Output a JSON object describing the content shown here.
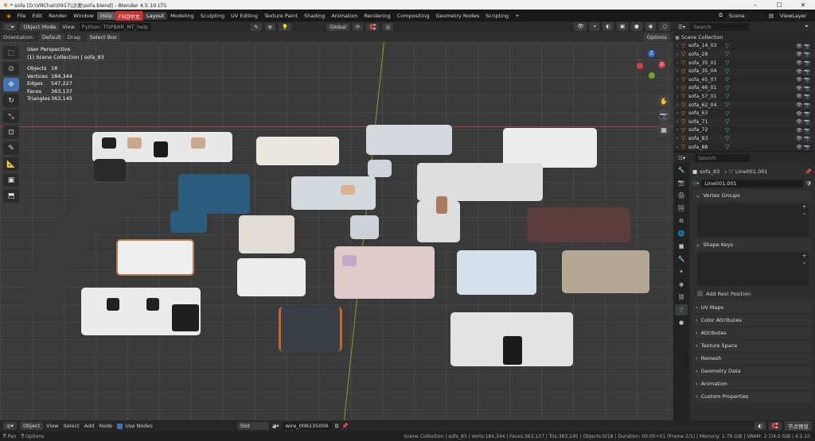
{
  "window": {
    "title": "* sofa [D:\\VRChat\\0917\\沙发\\sofa.blend] - Blender 4.5.10 LTS"
  },
  "menu": [
    "File",
    "Edit",
    "Render",
    "Window",
    "Help"
  ],
  "menu_extra": "FS切中文",
  "workspaces": [
    "Layout",
    "Modeling",
    "Sculpting",
    "UV Editing",
    "Texture Paint",
    "Shading",
    "Animation",
    "Rendering",
    "Compositing",
    "Geometry Nodes",
    "Scripting"
  ],
  "scene": {
    "label": "Scene",
    "view_layer": "ViewLayer"
  },
  "viewport_header": {
    "mode": "Object Mode",
    "view": "View",
    "tooltip": "Python: TOPBAR_MT_help",
    "transform": "Global"
  },
  "tool_header": {
    "orientation_label": "Orientation:",
    "orientation": "Default",
    "drag_label": "Drag:",
    "drag": "Select Box",
    "options": "Options"
  },
  "overlay_info": {
    "view": "User Perspective",
    "collection": "(1) Scene Collection | sofa_83",
    "stats": [
      {
        "k": "Objects",
        "v": "18"
      },
      {
        "k": "Vertices",
        "v": "184,344"
      },
      {
        "k": "Edges",
        "v": "547,227"
      },
      {
        "k": "Faces",
        "v": "363,137"
      },
      {
        "k": "Triangles",
        "v": "363,145"
      }
    ]
  },
  "outliner": {
    "search_placeholder": "Search",
    "root": "Scene Collection",
    "items": [
      "sofa_14_03",
      "sofa_28",
      "sofa_35_01",
      "sofa_35_04",
      "sofa_45_07",
      "sofa_46_01",
      "sofa_57_01",
      "sofa_62_04",
      "sofa_63",
      "sofa_71",
      "sofa_72",
      "sofa_83",
      "sofa_88"
    ]
  },
  "properties": {
    "search_placeholder": "Search",
    "object": "sofa_83",
    "mesh": "Line001.001",
    "mesh_field": "Line001.001",
    "vertex_groups": "Vertex Groups",
    "shape_keys": "Shape Keys",
    "add_rest": "Add Rest Position",
    "panels": [
      "UV Maps",
      "Color Attributes",
      "Attributes",
      "Texture Space",
      "Remesh",
      "Geometry Data",
      "Animation",
      "Custom Properties"
    ]
  },
  "node_header": {
    "editor": "Object",
    "menus": [
      "View",
      "Select",
      "Add",
      "Node"
    ],
    "use_nodes": "Use Nodes",
    "slot": "Slot",
    "material": "wire_006135006",
    "preview": "节点预览"
  },
  "status": {
    "left": [
      "Pan",
      "Options"
    ],
    "right": "Scene Collection | sofa_83 | Verts:184,344 | Faces:363,137 | Tris:363,145 | Objects:0/18 | Duration: 00:00+01 (Frame 2/1) | Memory: 1.79 GiB | VRAM: 2.7/4.0 GiB | 4.5.10"
  },
  "colors": {
    "accent": "#4772b3",
    "mesh": "#5cc29c",
    "object": "#e09550",
    "x_axis": "#c04050",
    "y_axis": "#8ab030"
  }
}
